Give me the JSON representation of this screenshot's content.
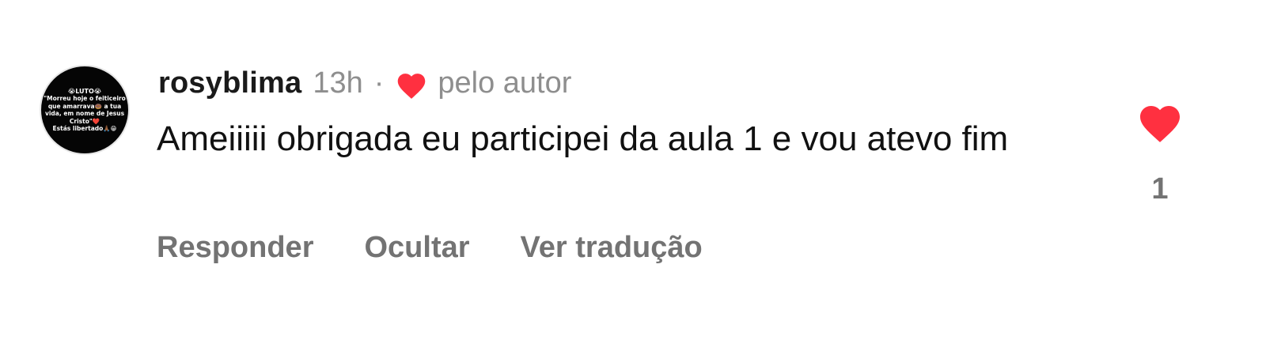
{
  "comment": {
    "avatar": {
      "lines": [
        "😭LUTO😭",
        "\"Morreu hoje o feiticeiro",
        "que amarrava🍩 a tua",
        "vida, em nome de Jesus",
        "Cristo\"❤️",
        "Estás libertado🙏🏾😁"
      ]
    },
    "username": "rosyblima",
    "time": "13h",
    "separator": "·",
    "author_like_label": "pelo autor",
    "text": "Ameiiiii obrigada eu participei da aula 1 e vou atevo fim",
    "actions": {
      "reply": "Responder",
      "hide": "Ocultar",
      "translate": "Ver tradução"
    },
    "like": {
      "count": "1",
      "liked": true
    }
  },
  "colors": {
    "heart": "#ff3040",
    "secondary_text": "#8e8e8e",
    "action_text": "#737373",
    "primary_text": "#111111"
  },
  "icons": {
    "author_heart": "heart-filled-icon",
    "like": "heart-filled-icon"
  }
}
